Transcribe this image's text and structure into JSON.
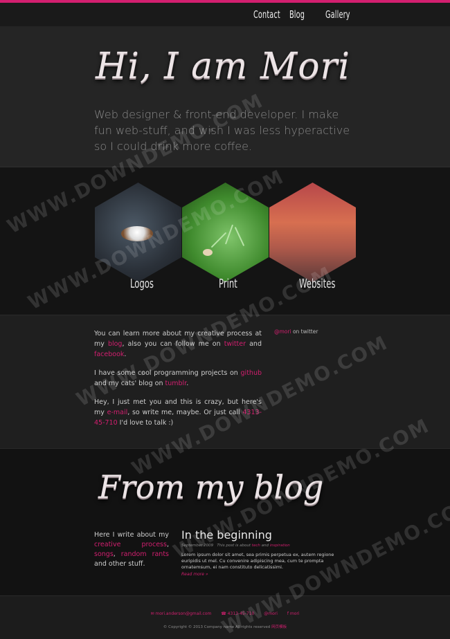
{
  "nav": {
    "items": [
      "Contact",
      "Blog",
      "Gallery"
    ]
  },
  "hero": {
    "title": "Hi, I am Mori",
    "subtitle": "Web designer & front-end developer. I make fun web-stuff, and wish I was less hyperactive so I could drink more coffee."
  },
  "gallery": {
    "items": [
      {
        "label": "Logos"
      },
      {
        "label": "Print"
      },
      {
        "label": "Websites"
      }
    ]
  },
  "about": {
    "p1_a": "You can learn more about my creative process at my ",
    "p1_link1": "blog",
    "p1_b": ", also you can follow me on ",
    "p1_link2": "twitter",
    "p1_c": " and ",
    "p1_link3": "facebook",
    "p1_d": ".",
    "p2_a": "I have some cool programming projects on ",
    "p2_link1": "github",
    "p2_b": " and my cats' blog on ",
    "p2_link2": "tumblr",
    "p2_c": ".",
    "p3_a": "Hey, I just met you and this is crazy, but here's my ",
    "p3_link1": "e-mail",
    "p3_b": ", so write me, maybe. Or just call ",
    "p3_link2": "4313-45-710",
    "p3_c": " I'd love to talk :)",
    "twitter_handle": "@mori",
    "twitter_label": " on twitter"
  },
  "blog": {
    "title": "From my blog",
    "intro_a": "Here I write about my ",
    "intro_link1": "creative process",
    "intro_b": ", ",
    "intro_link2": "songs",
    "intro_c": ", ",
    "intro_link3": "random rants",
    "intro_d": " and other stuff.",
    "post": {
      "title": "In the beginning",
      "meta_date": "September 2009",
      "meta_text": "This post is about",
      "meta_tag1": "tech",
      "meta_and": "and",
      "meta_tag2": "inspiration",
      "body": "Lorem ipsum dolor sit amet, sea primis perpetua ex, autem regione euripidis ut mel. Cu convenire adipiscing mea, cum te prompta ornatemsum, ei nam constituto delicatissimi.",
      "more": "Read more »"
    }
  },
  "footer": {
    "links": [
      "✉ mori.anderson@gmail.com",
      "☎ 4313-45-710",
      "@mori",
      "f mori"
    ],
    "copyright": "© Copyright © 2013 Company name All rights reserved",
    "copyright_link": "网页模板"
  },
  "watermark": "WWW.DOWNDEMO.COM",
  "colors": {
    "accent": "#d21f6f",
    "background": "#1c1c1c"
  }
}
